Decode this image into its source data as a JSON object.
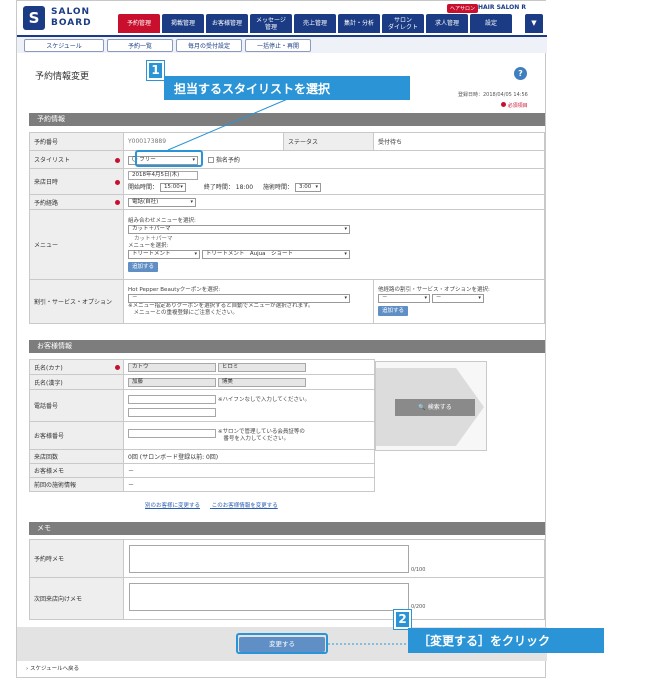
{
  "header": {
    "logo_mark": "S",
    "logo_line1": "SALON",
    "logo_line2": "BOARD",
    "shop_badge": "ヘアサロン",
    "shop_name": "HAIR SALON R",
    "nav": [
      {
        "label": "予約管理",
        "active": true
      },
      {
        "label": "掲載管理",
        "active": false
      },
      {
        "label": "お客様管理",
        "active": false
      },
      {
        "label": "メッセージ\n管理",
        "active": false
      },
      {
        "label": "売上管理",
        "active": false
      },
      {
        "label": "集計・分析",
        "active": false
      },
      {
        "label": "サロン\nダイレクト",
        "active": false
      },
      {
        "label": "求人管理",
        "active": false
      },
      {
        "label": "設定",
        "active": false
      }
    ],
    "dropdown_icon": "▼"
  },
  "subnav": [
    "スケジュール",
    "予約一覧",
    "毎月の受付設定",
    "一括停止・再開"
  ],
  "page": {
    "title": "予約情報変更",
    "help_icon": "?",
    "reg_date": "登録日時：2018/04/05 14:56",
    "required_note": "必須項目"
  },
  "reservation": {
    "section": "予約情報",
    "rows": {
      "number_label": "予約番号",
      "number_value": "Y000173889",
      "status_label": "ステータス",
      "status_value": "受付待ち",
      "stylist_label": "スタイリスト",
      "stylist_value": "〇 フリー",
      "nominate_label": "指名予約",
      "date_label": "来店日時",
      "date_value": "2018年4月5日(木)",
      "start_label": "開始時間：",
      "start_value": "15:00",
      "end_label": "終了時間：",
      "end_value": "18:00",
      "duration_label": "施術時間：",
      "duration_value": "3:00",
      "route_label": "予約経路",
      "route_value": "電話(自社)",
      "menu_label": "メニュー",
      "menu_combo_label": "組み合わせメニューを選択:",
      "menu_combo_value": "カット＋パーマ",
      "menu_combo_note": "カット＋パーマ",
      "menu_select_label": "メニューを選択:",
      "menu_cat_value": "トリートメント",
      "menu_item_value": "トリートメント　Aujua　ショート",
      "add_label": "追加する",
      "option_label": "割引・サービス・オプション",
      "coupon_label": "Hot Pepper Beautyクーポンを選択:",
      "coupon_value": "－",
      "coupon_note1": "※メニュー指定ありクーポンを選択すると自動でメニューが選択されます。",
      "coupon_note2": "　メニューとの重複登録にご注意ください。",
      "other_label": "他経路の割引・サービス・オプションを選択:",
      "other_value1": "－",
      "other_value2": "－",
      "other_add_label": "追加する"
    }
  },
  "customer": {
    "section": "お客様情報",
    "kana_label": "氏名(カナ)",
    "kana_last": "カトウ",
    "kana_first": "ヒロミ",
    "kanji_label": "氏名(漢字)",
    "kanji_last": "加藤",
    "kanji_first": "博美",
    "phone_label": "電話番号",
    "phone_note": "※ハイフンなしで入力してください。",
    "member_label": "お客様番号",
    "member_note1": "※サロンで管理している会員証等の",
    "member_note2": "　番号を入力してください。",
    "visits_label": "来店回数",
    "visits_value": "0回 (サロンボード登録以前: 0回)",
    "memo_label": "お客様メモ",
    "memo_value": "－",
    "history_label": "前回の施術情報",
    "history_value": "－",
    "search_label": "検索する",
    "link1": "別のお客様に変更する",
    "link2": "このお客様情報を変更する"
  },
  "memo": {
    "section": "メモ",
    "reservation_memo_label": "予約時メモ",
    "reservation_counter": "0/100",
    "next_memo_label": "次回来店向けメモ",
    "next_counter": "0/200"
  },
  "footer": {
    "submit_label": "変更する",
    "back_label": "スケジュールへ戻る"
  },
  "callouts": {
    "one_num": "1",
    "one_text": "担当するスタイリストを選択",
    "two_num": "2",
    "two_text": "［変更する］をクリック",
    "accent": "#2a94d6"
  }
}
